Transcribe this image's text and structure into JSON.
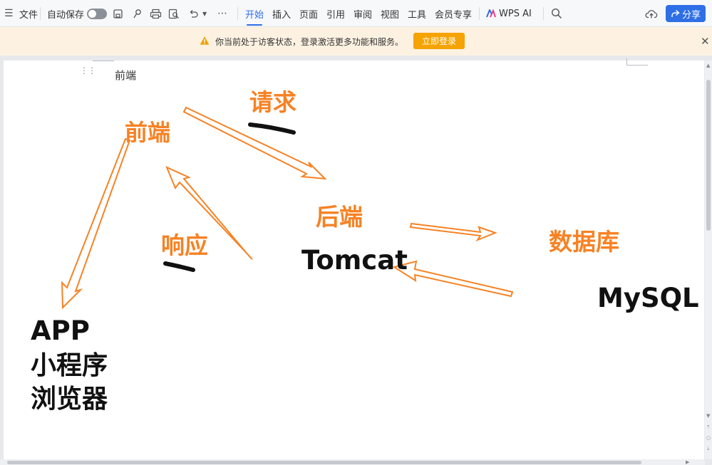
{
  "toolbar": {
    "file_label": "文件",
    "autosave_label": "自动保存",
    "tabs": [
      "开始",
      "插入",
      "页面",
      "引用",
      "审阅",
      "视图",
      "工具",
      "会员专享"
    ],
    "wps_ai_label": "WPS AI",
    "share_label": "分享"
  },
  "notice": {
    "message": "你当前处于访客状态，登录激活更多功能和服务。",
    "login_button": "立即登录"
  },
  "document": {
    "header_text": "前端",
    "labels": {
      "request": "请求",
      "frontend": "前端",
      "response": "响应",
      "backend": "后端",
      "tomcat": "Tomcat",
      "database": "数据库",
      "mysql": "MySQL",
      "app": "APP",
      "mini_program": "小程序",
      "browser": "浏览器"
    }
  },
  "colors": {
    "accent": "#2e6fe6",
    "annotation_orange": "#f78224",
    "login_button": "#f5a300",
    "notice_bg": "#fdf2e2"
  }
}
